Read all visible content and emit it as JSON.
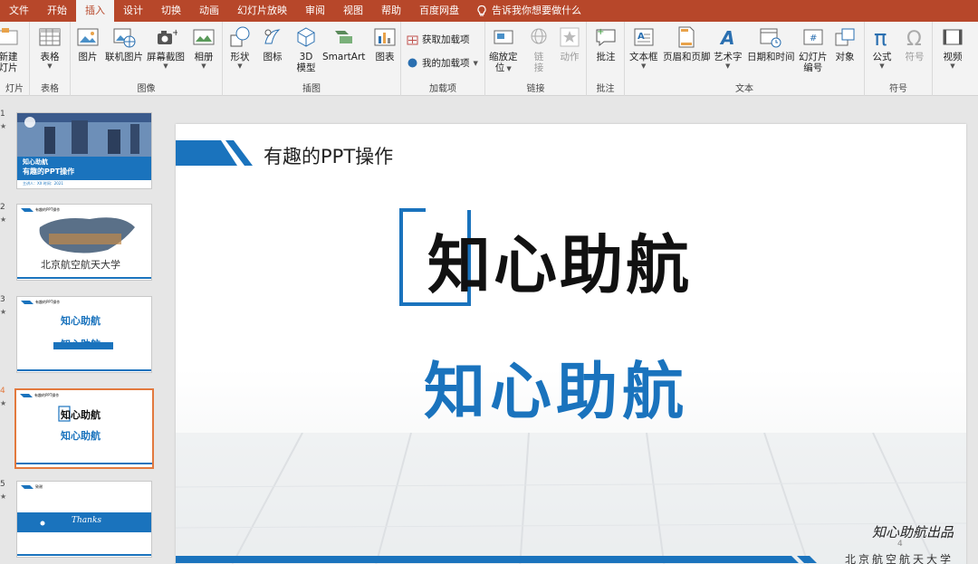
{
  "tabs": [
    {
      "label": "文件",
      "active": false
    },
    {
      "label": "开始",
      "active": false
    },
    {
      "label": "插入",
      "active": true
    },
    {
      "label": "设计",
      "active": false
    },
    {
      "label": "切换",
      "active": false
    },
    {
      "label": "动画",
      "active": false
    },
    {
      "label": "幻灯片放映",
      "active": false
    },
    {
      "label": "审阅",
      "active": false
    },
    {
      "label": "视图",
      "active": false
    },
    {
      "label": "帮助",
      "active": false
    },
    {
      "label": "百度网盘",
      "active": false
    }
  ],
  "tell_me": "告诉我你想要做什么",
  "ribbon": {
    "slides": {
      "new_slide_line1": "新建",
      "new_slide_line2": "灯片",
      "group": "灯片"
    },
    "table": {
      "label": "表格",
      "group": "表格"
    },
    "images": {
      "picture": "图片",
      "online": "联机图片",
      "screenshot": "屏幕截图",
      "album": "相册",
      "group": "图像"
    },
    "illustrations": {
      "shapes": "形状",
      "icons": "图标",
      "model3d_line1": "3D",
      "model3d_line2": "模型",
      "smartart": "SmartArt",
      "chart": "图表",
      "group": "插图"
    },
    "addins": {
      "get": "获取加载项",
      "mine": "我的加载项",
      "group": "加载项"
    },
    "links": {
      "zoom_line1": "缩放定",
      "zoom_line2": "位",
      "link_line1": "链",
      "link_line2": "接",
      "action": "动作",
      "group": "链接"
    },
    "comments": {
      "comment": "批注",
      "group": "批注"
    },
    "text": {
      "textbox": "文本框",
      "header": "页眉和页脚",
      "wordart": "艺术字",
      "datetime": "日期和时间",
      "slidenum_line1": "幻灯片",
      "slidenum_line2": "编号",
      "object": "对象",
      "group": "文本"
    },
    "symbols": {
      "equation": "公式",
      "symbol": "符号",
      "group": "符号"
    },
    "media": {
      "video": "视频"
    }
  },
  "thumbnails": [
    {
      "num": "1",
      "title1": "知心助航",
      "title2": "有趣的PPT操作",
      "meta": "主讲人：XX  时间：2021"
    },
    {
      "num": "2",
      "header": "有趣的PPT操作",
      "text": "北京航空航天大学"
    },
    {
      "num": "3",
      "header": "有趣的PPT操作",
      "text1": "知心助航",
      "text2": "知心助航"
    },
    {
      "num": "4",
      "header": "有趣的PPT操作",
      "text1": "知心助航",
      "text2": "知心助航"
    },
    {
      "num": "5",
      "header": "致谢",
      "text": "Thanks"
    }
  ],
  "slide": {
    "title": "有趣的PPT操作",
    "main_black": "知心助航",
    "main_blue": "知心助航",
    "signature": "知心助航出品",
    "page_number": "4",
    "university": "北京航空航天大学"
  },
  "colors": {
    "tab_red": "#b7472a",
    "accent_blue": "#1a73bd",
    "selection_orange": "#e2793e"
  }
}
